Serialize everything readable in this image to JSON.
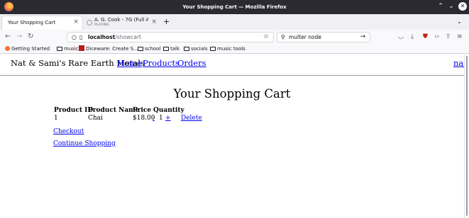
{
  "window": {
    "title": "Your Shopping Cart — Mozilla Firefox"
  },
  "tabs": [
    {
      "label": "Your Shopping Cart",
      "active": true
    },
    {
      "label": "A. G. Cook - 7G (Full Alb",
      "sublabel": "PLAYING",
      "active": false
    }
  ],
  "url": {
    "host": "localhost",
    "path": "/showcart"
  },
  "search": {
    "value": "multer node"
  },
  "bookmarks": [
    {
      "label": "Getting Started",
      "icon": "firefox-icon"
    },
    {
      "label": "music",
      "icon": "folder-icon"
    },
    {
      "label": "Diceware: Create S...",
      "icon": "diceware-icon"
    },
    {
      "label": "school",
      "icon": "folder-icon"
    },
    {
      "label": "talk",
      "icon": "folder-icon"
    },
    {
      "label": "socials",
      "icon": "folder-icon"
    },
    {
      "label": "music tools",
      "icon": "folder-icon"
    }
  ],
  "site": {
    "brand": "Nat & Sami's Rare Earth Metals",
    "nav": [
      "Home",
      "Products",
      "Orders"
    ],
    "user": "nat"
  },
  "page": {
    "title": "Your Shopping Cart"
  },
  "cart": {
    "headers": [
      "Product ID",
      "Product Name",
      "Price",
      "Quantity"
    ],
    "rows": [
      {
        "id": "1",
        "name": "Chai",
        "price": "$18.00",
        "decrement": "-",
        "quantity": "1",
        "increment": "+",
        "delete": "Delete"
      }
    ]
  },
  "links": {
    "checkout": "Checkout",
    "continue": "Continue Shopping"
  },
  "colors": {
    "link": "#0000ee",
    "titlebar": "#2b2a33",
    "tabstrip": "#f0f0f4"
  }
}
